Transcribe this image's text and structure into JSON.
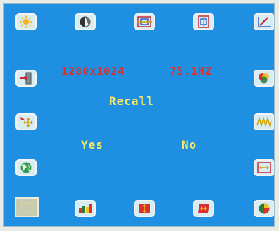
{
  "osd": {
    "resolution": "1280x1024",
    "refresh_rate": "75.1HZ",
    "title": "Recall",
    "yes_label": "Yes",
    "no_label": "No"
  },
  "icons": {
    "top": [
      "brightness-icon",
      "contrast-icon",
      "h-size-icon",
      "v-size-icon",
      "linearity-icon"
    ],
    "left": [
      "input-select-icon",
      "position-icon",
      "language-icon",
      "osd-position-icon"
    ],
    "right": [
      "color-temperature-icon",
      "moire-icon",
      "h-position-icon"
    ],
    "bottom": [
      "recall-icon",
      "tilt-icon",
      "pincushion-icon",
      "trapezoid-icon",
      "color-balance-icon"
    ]
  },
  "colors": {
    "screen_bg": "#1f8fe2",
    "text_red": "#d8322e",
    "text_yellow": "#f2e76b",
    "selected_tile": "#c7cbb1"
  }
}
